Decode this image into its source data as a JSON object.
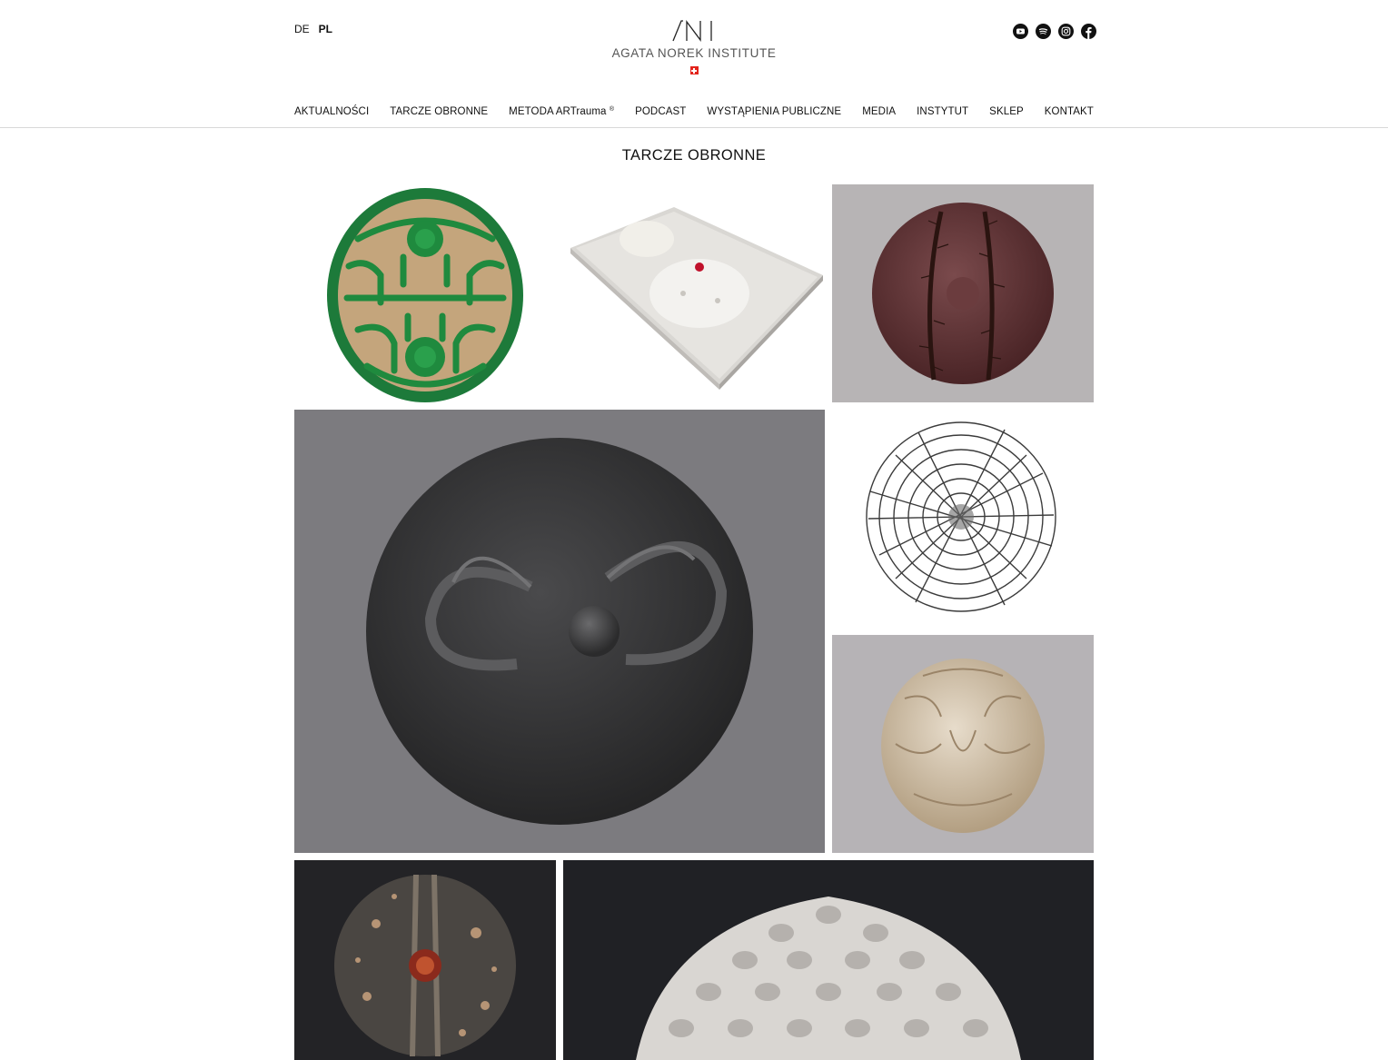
{
  "lang": {
    "de": "DE",
    "pl": "PL",
    "active": "PL"
  },
  "logo": {
    "monogram": "ANI",
    "name": "AGATA NOREK INSTITUTE"
  },
  "social": [
    "youtube-icon",
    "spotify-icon",
    "instagram-icon",
    "facebook-icon"
  ],
  "nav": {
    "aktualnosci": "AKTUALNOŚCI",
    "tarcze": "TARCZE OBRONNE",
    "metoda": "METODA ARTrauma",
    "metoda_mark": "®",
    "podcast": "PODCAST",
    "wystapienia": "WYSTĄPIENIA PUBLICZNE",
    "media": "MEDIA",
    "instytut": "INSTYTUT",
    "sklep": "SKLEP",
    "kontakt": "KONTAKT"
  },
  "page": {
    "title": "TARCZE OBRONNE"
  },
  "colors": {
    "accent": "#e3231b",
    "text": "#111111",
    "divider": "#d8d8d8"
  }
}
